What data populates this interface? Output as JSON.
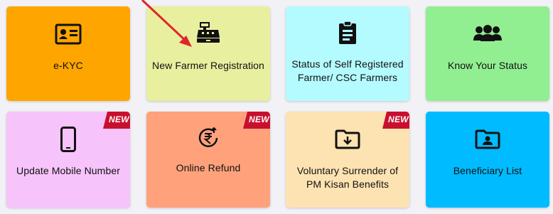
{
  "tiles": [
    {
      "label": "e-KYC",
      "color": "#ffa500",
      "icon": "id-card-icon"
    },
    {
      "label": "New Farmer Registration",
      "color": "#e8ef9f",
      "icon": "cash-register-icon"
    },
    {
      "label": "Status of Self Registered Farmer/ CSC Farmers",
      "color": "#b4fbff",
      "icon": "clipboard-list-icon"
    },
    {
      "label": "Know Your Status",
      "color": "#91ee91",
      "icon": "users-icon"
    },
    {
      "label": "Update Mobile Number",
      "color": "#f6c3fb",
      "icon": "mobile-phone-icon",
      "badge": "NEW"
    },
    {
      "label": "Online Refund",
      "color": "#ffa27c",
      "icon": "rupee-refund-icon",
      "badge": "NEW"
    },
    {
      "label": "Voluntary Surrender of PM Kisan Benefits",
      "color": "#fee3b2",
      "icon": "folder-download-icon",
      "badge": "NEW"
    },
    {
      "label": "Beneficiary List",
      "color": "#00bbff",
      "icon": "folder-user-icon"
    }
  ],
  "colors": {
    "badge": "#c8102e",
    "arrow": "#e0262a"
  }
}
